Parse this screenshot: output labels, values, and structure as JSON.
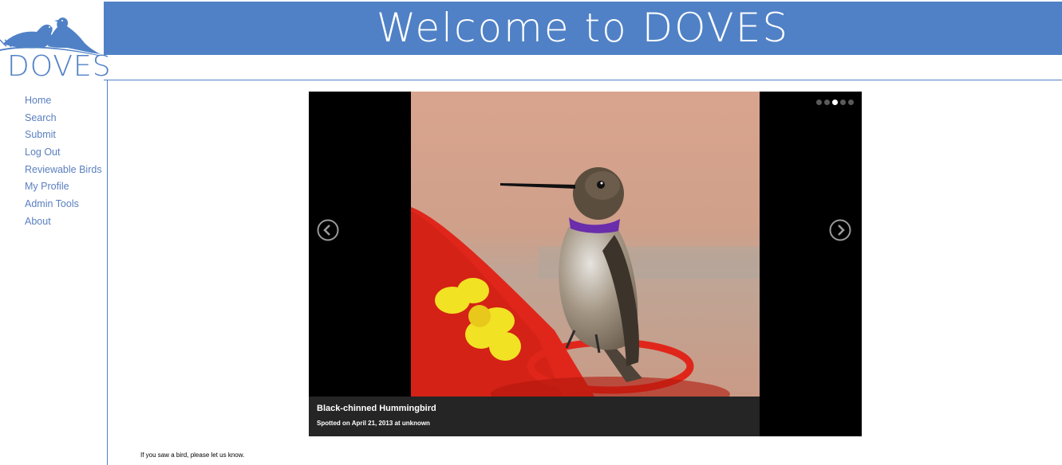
{
  "header": {
    "title": "Welcome to DOVES"
  },
  "logo": {
    "text": "DOVES"
  },
  "nav": {
    "items": [
      {
        "label": "Home"
      },
      {
        "label": "Search"
      },
      {
        "label": "Submit"
      },
      {
        "label": "Log Out"
      },
      {
        "label": "Reviewable Birds"
      },
      {
        "label": "My Profile"
      },
      {
        "label": "Admin Tools"
      },
      {
        "label": "About"
      }
    ]
  },
  "slider": {
    "caption_title": "Black-chinned Hummingbird",
    "caption_sub": "Spotted on April 21, 2013 at unknown",
    "prev_icon": "chevron-left-icon",
    "next_icon": "chevron-right-icon",
    "slide_count": 5,
    "active_slide": 3
  },
  "footer": {
    "note": "If you saw a bird, please let us know."
  },
  "colors": {
    "brand": "#5081c6",
    "nav_link": "#5a7fc0",
    "slider_bg": "#000000"
  }
}
